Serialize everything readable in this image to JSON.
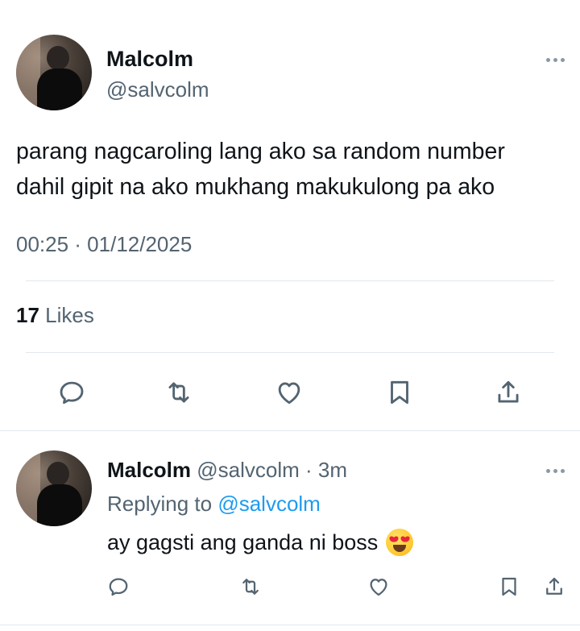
{
  "main_tweet": {
    "author_name": "Malcolm",
    "author_handle": "@salvcolm",
    "text_line1": "parang nagcaroling lang ako sa random number",
    "text_line2": "dahil gipit na ako mukhang makukulong pa ako",
    "timestamp": "00:25 · 01/12/2025",
    "likes_count": "17",
    "likes_label": "Likes",
    "actions": [
      "reply-icon",
      "retweet-icon",
      "like-icon",
      "bookmark-icon",
      "share-icon"
    ]
  },
  "reply": {
    "author_name": "Malcolm",
    "author_handle_time": "@salvcolm · 3m",
    "replying_to_label": "Replying to",
    "replying_to_handle": "@salvcolm",
    "text": "ay gagsti ang ganda ni boss",
    "emoji": "smiling-face-with-heart-eyes",
    "actions": [
      "reply-icon",
      "retweet-icon",
      "like-icon",
      "bookmark-icon",
      "share-icon"
    ]
  },
  "colors": {
    "text_primary": "#0f1419",
    "text_secondary": "#536471",
    "link": "#1d9bf0",
    "divider": "#e1e8ed"
  }
}
